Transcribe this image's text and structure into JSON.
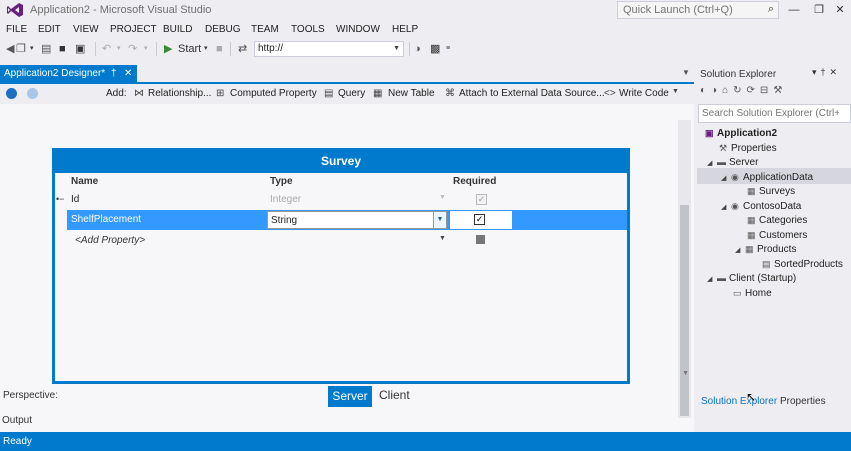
{
  "window": {
    "title": "Application2 - Microsoft Visual Studio",
    "quick_launch_placeholder": "Quick Launch (Ctrl+Q)"
  },
  "menu": [
    "FILE",
    "EDIT",
    "VIEW",
    "PROJECT",
    "BUILD",
    "DEBUG",
    "TEAM",
    "TOOLS",
    "WINDOW",
    "HELP"
  ],
  "toolbar": {
    "start_label": "Start",
    "url_value": "http://"
  },
  "document_tab": {
    "label": "Application2 Designer*"
  },
  "designer_toolbar": {
    "add_label": "Add:",
    "relationship": "Relationship...",
    "computed_property": "Computed Property",
    "query": "Query",
    "new_table": "New Table",
    "attach": "Attach to External Data Source...",
    "write_code": "Write Code"
  },
  "entity": {
    "title": "Survey",
    "headers": {
      "name": "Name",
      "type": "Type",
      "required": "Required"
    },
    "rows": [
      {
        "name": "Id",
        "type": "Integer",
        "required": true
      },
      {
        "name": "ShelfPlacement",
        "type": "String",
        "required": true
      },
      {
        "name": "<Add Property>",
        "type": "",
        "required": false
      }
    ]
  },
  "perspective": {
    "label": "Perspective:",
    "server": "Server",
    "client": "Client"
  },
  "output_label": "Output",
  "status": "Ready",
  "solution_explorer": {
    "title": "Solution Explorer",
    "search_placeholder": "Search Solution Explorer (Ctrl+;",
    "tree": [
      {
        "label": "Application2",
        "level": 0,
        "bold": true,
        "icon": "solution-icon"
      },
      {
        "label": "Properties",
        "level": 1,
        "icon": "wrench-icon"
      },
      {
        "label": "Server",
        "level": 1,
        "icon": "server-icon"
      },
      {
        "label": "ApplicationData",
        "level": 2,
        "icon": "datasource-icon"
      },
      {
        "label": "Surveys",
        "level": 3,
        "icon": "table-icon"
      },
      {
        "label": "ContosoData",
        "level": 2,
        "icon": "datasource-icon"
      },
      {
        "label": "Categories",
        "level": 3,
        "icon": "table-icon"
      },
      {
        "label": "Customers",
        "level": 3,
        "icon": "table-icon"
      },
      {
        "label": "Products",
        "level": 3,
        "icon": "table-icon"
      },
      {
        "label": "SortedProducts",
        "level": 4,
        "icon": "query-icon"
      },
      {
        "label": "Client (Startup)",
        "level": 1,
        "icon": "client-icon"
      },
      {
        "label": "Home",
        "level": 2,
        "icon": "screen-icon"
      }
    ],
    "bottom_tabs": {
      "active": "Solution Explorer",
      "other": "Properties"
    }
  },
  "colors": {
    "accent": "#007acc",
    "selection": "#3399ff"
  }
}
